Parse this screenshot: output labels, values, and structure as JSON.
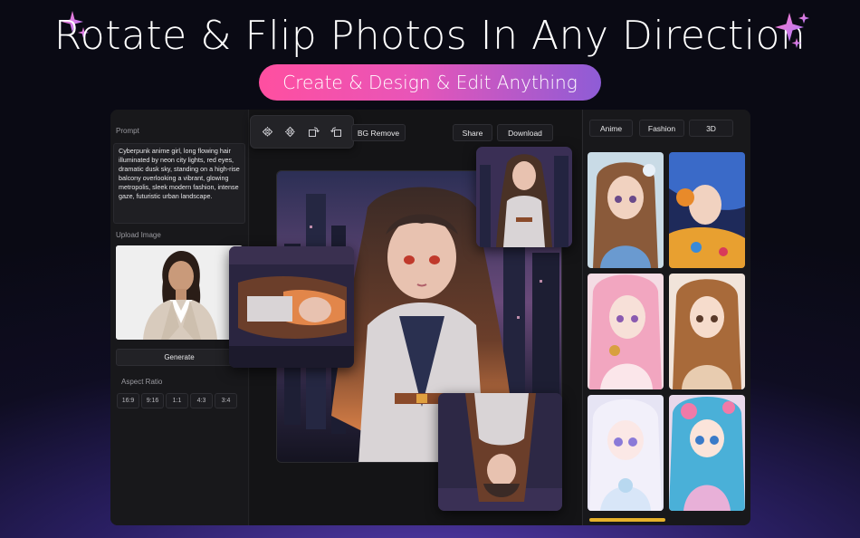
{
  "hero": {
    "title": "Rotate & Flip  Photos In Any Direction",
    "subtitle": "Create & Design & Edit Anything"
  },
  "left_panel": {
    "prompt_label": "Prompt",
    "prompt_text": "Cyberpunk anime girl, long flowing hair illuminated by neon city lights, red eyes, dramatic dusk sky, standing on a high-rise balcony overlooking a vibrant, glowing metropolis, sleek modern fashion, intense gaze, futuristic urban landscape.",
    "upload_label": "Upload Image",
    "generate_label": "Generate",
    "aspect_label": "Aspect Ratio",
    "ratios": [
      "16:9",
      "9:16",
      "1:1",
      "4:3",
      "3:4"
    ]
  },
  "toolbar": {
    "icons": [
      "flip-horizontal-icon",
      "flip-vertical-icon",
      "rotate-right-icon",
      "rotate-left-icon"
    ],
    "bg_remove_label": "BG Remove",
    "share_label": "Share",
    "download_label": "Download"
  },
  "right_panel": {
    "categories": [
      "Anime",
      "Fashion",
      "3D"
    ]
  },
  "colors": {
    "pill_start": "#ff4fa0",
    "pill_end": "#8e5cd6",
    "panel_bg": "#18181b",
    "accent_scroll": "#e6b12a"
  }
}
